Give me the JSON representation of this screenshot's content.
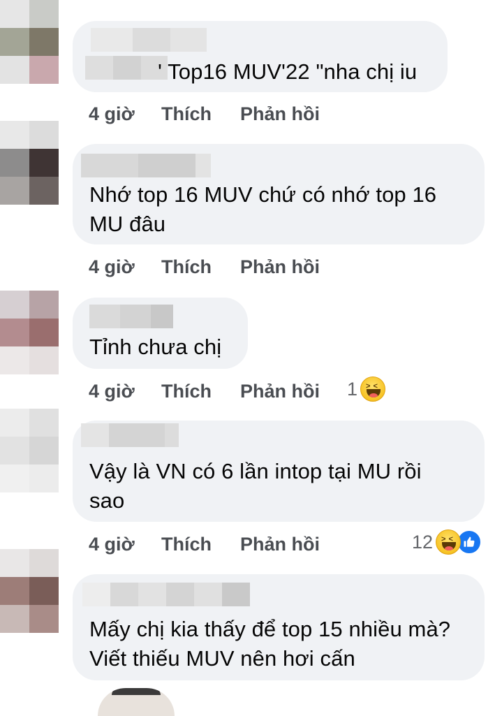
{
  "comments": [
    {
      "text": "' Top16 MUV'22 \"nha chị iu",
      "time": "4 giờ",
      "like": "Thích",
      "reply": "Phản hồi",
      "reaction_count": ""
    },
    {
      "text": "Nhớ top 16 MUV chứ có nhớ top 16 MU đâu",
      "time": "4 giờ",
      "like": "Thích",
      "reply": "Phản hồi",
      "reaction_count": ""
    },
    {
      "text": "Tỉnh chưa chị",
      "time": "4 giờ",
      "like": "Thích",
      "reply": "Phản hồi",
      "reaction_count": "1",
      "reaction_icons": [
        "haha-icon"
      ]
    },
    {
      "text": "Vậy là VN có 6 lần intop tại MU rồi sao",
      "time": "4 giờ",
      "like": "Thích",
      "reply": "Phản hồi",
      "reaction_count": "12",
      "reaction_icons": [
        "haha-icon",
        "like-icon"
      ]
    },
    {
      "text": "Mấy chị kia thấy để top 15 nhiều mà?\nViết thiếu MUV nên hơi cấn",
      "time": "",
      "like": "",
      "reply": "",
      "reaction_count": ""
    }
  ],
  "colors": {
    "bubble": "#f0f2f5",
    "action_text": "#4a4d52",
    "like_blue": "#1877f2",
    "haha_yellow": "#f7c325"
  }
}
